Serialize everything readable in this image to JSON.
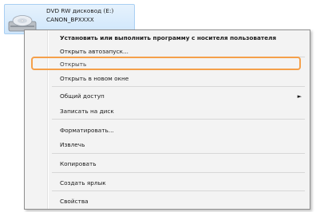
{
  "drive": {
    "name": "DVD RW дисковод (E:)",
    "label": "CANON_BPXXXX",
    "icon": "dvd-drive-icon"
  },
  "menu": {
    "items": [
      {
        "label": "Установить или выполнить программу с носителя пользователя",
        "bold": true
      },
      {
        "label": "Открыть автозапуск..."
      },
      {
        "label": "Открыть",
        "highlighted": true
      },
      {
        "label": "Открыть в новом окне"
      },
      {
        "label": "Общий доступ",
        "submenu": true
      },
      {
        "label": "Записать на диск"
      },
      {
        "label": "Форматировать..."
      },
      {
        "label": "Извлечь"
      },
      {
        "label": "Копировать"
      },
      {
        "label": "Создать ярлык"
      },
      {
        "label": "Свойства"
      }
    ],
    "submenu_arrow": "►",
    "highlight_color": "#f5a04a"
  }
}
